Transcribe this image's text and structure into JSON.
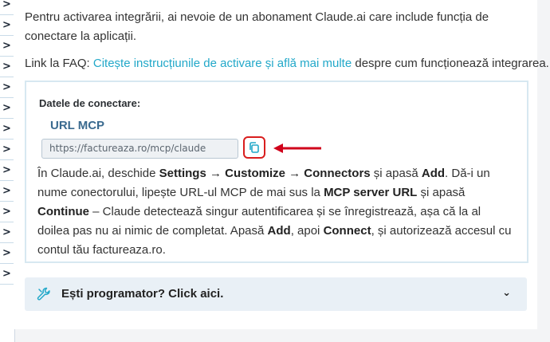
{
  "rail": {
    "items": [
      ">",
      ">",
      ">",
      ">",
      ">",
      ">",
      ">",
      ">",
      ">",
      ">",
      ">",
      ">",
      ">",
      ">"
    ]
  },
  "intro": {
    "text": "Pentru activarea integrării, ai nevoie de un abonament Claude.ai care include funcția de conectare la aplicații."
  },
  "faq": {
    "prefix": "Link la FAQ: ",
    "link": "Citește instrucțiunile de activare și află mai multe",
    "suffix": " despre cum funcționează integrarea."
  },
  "connection": {
    "title": "Datele de conectare:",
    "url_label": "URL MCP",
    "url_value": "https://factureaza.ro/mcp/claude",
    "copy_icon": "copy-icon",
    "instructions": {
      "t1": "În Claude.ai, deschide ",
      "settings": "Settings → Customize → Connectors",
      "t2": " și apasă ",
      "add": "Add",
      "t3": ". Dă-i un nume conectorului, lipește URL-ul MCP de mai sus la ",
      "mcp_url": "MCP server URL",
      "t4": " și apasă ",
      "continue": "Continue",
      "t5": " – Claude detectează singur autentificarea și se înregistrează, așa că la al doilea pas nu ai nimic de completat. Apasă ",
      "add2": "Add",
      "t6": ", apoi ",
      "connect": "Connect",
      "t7": ", și autorizează accesul cu contul tău factureaza.ro."
    }
  },
  "developer": {
    "label": "Ești programator? Click aici.",
    "icon": "wrench-icon",
    "chevron": "⌄"
  },
  "colors": {
    "link": "#22a8c9",
    "highlight_border": "#d91e1e",
    "arrow": "#d0021b",
    "url_label": "#3a6a8f",
    "box_border": "#d7e8f1",
    "dev_bar_bg": "#e9f0f6"
  }
}
